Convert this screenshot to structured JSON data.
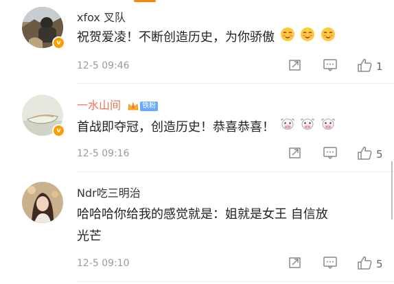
{
  "comments": [
    {
      "username": "xfox 叉队",
      "text": "祝贺爱凌！不断创造历史，为你骄傲",
      "emoji": [
        "blush-icon",
        "blush-icon",
        "blush-icon"
      ],
      "time": "12-5 09:46",
      "likes": "1",
      "verified": true
    },
    {
      "username": "一水山间",
      "badge": "铁粉",
      "text": "首战即夺冠，创造历史！恭喜恭喜！",
      "emoji": [
        "cow-icon",
        "cow-icon",
        "cow-icon"
      ],
      "time": "12-5 09:16",
      "likes": "5",
      "verified": true
    },
    {
      "username": "Ndr吃三明治",
      "text_line1": "哈哈哈你给我的感觉就是：姐就是女王 自信放",
      "text_line2": "光芒",
      "time": "12-5 09:10",
      "likes": "5",
      "verified": false
    }
  ],
  "colors": {
    "accent": "#ff8200",
    "highlight_name": "#eb7350",
    "meta": "#9a9a9a",
    "fan_badge": "#6ba6ff"
  }
}
